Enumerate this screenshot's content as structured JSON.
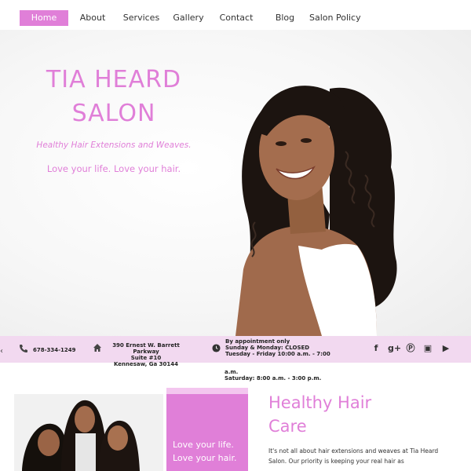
{
  "nav": {
    "items": [
      {
        "label": "Home",
        "active": true
      },
      {
        "label": "About"
      },
      {
        "label": "Services"
      },
      {
        "label": "Gallery"
      },
      {
        "label": "Contact"
      },
      {
        "label": "Blog"
      },
      {
        "label": "Salon Policy"
      }
    ]
  },
  "hero": {
    "title_line1": "TIA HEARD",
    "title_line2": "SALON",
    "tagline": "Healthy Hair Extensions and Weaves.",
    "subline": "Love your life. Love your hair."
  },
  "info_bar": {
    "phone": "678-334-1249",
    "address_line1": "390 Ernest W. Barrett",
    "address_line2": "Parkway",
    "address_line3": "Suite #10",
    "address_line4": "Kennesaw, Ga 30144",
    "hours_line1": "By appointment only",
    "hours_line2": "Sunday & Monday: CLOSED",
    "hours_line3": "Tuesday - Friday 10:00 a.m. - 7:00",
    "hours_line4": "a.m.",
    "hours_line5": "Saturday: 8:00 a.m. - 3:00 p.m.",
    "social": [
      "facebook-icon",
      "google-plus-icon",
      "pinterest-icon",
      "instagram-icon",
      "youtube-icon"
    ]
  },
  "bottom": {
    "pink_box_text": "Love your life. Love your hair.",
    "care_title_line1": "Healthy Hair",
    "care_title_line2": "Care",
    "care_text": "It's not all about hair extensions and weaves at Tia Heard Salon. Our priority is keeping your real hair as"
  },
  "colors": {
    "accent": "#e07fd8",
    "info_bar_bg": "#f2d9f0"
  }
}
